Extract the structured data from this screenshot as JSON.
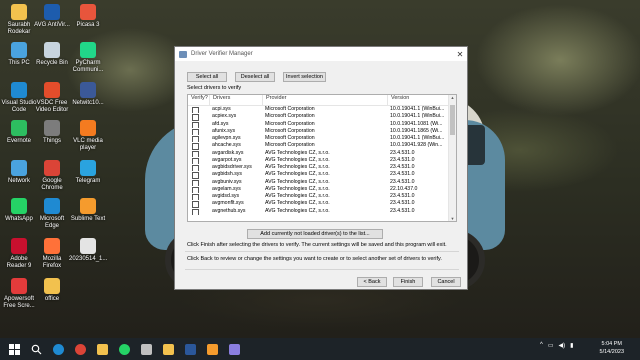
{
  "desktop_icons": [
    {
      "label": "Saurabh Rodekar",
      "icon": "user-folder-icon",
      "color": "#f2c14e"
    },
    {
      "label": "AVG AntiVir...",
      "icon": "avg-icon",
      "color": "#1d5cad"
    },
    {
      "label": "Picasa 3",
      "icon": "picasa-icon",
      "color": "#e8553c"
    },
    {
      "label": "This PC",
      "icon": "computer-icon",
      "color": "#4aa3df"
    },
    {
      "label": "Recycle Bin",
      "icon": "recycle-bin-icon",
      "color": "#c7d4de"
    },
    {
      "label": "PyCharm Communi...",
      "icon": "pycharm-icon",
      "color": "#21d789"
    },
    {
      "label": "Visual Studio Code",
      "icon": "vscode-icon",
      "color": "#1f8ad2"
    },
    {
      "label": "VSDC Free Video Editor",
      "icon": "vsdc-icon",
      "color": "#e34d2b"
    },
    {
      "label": "Netwitc10...",
      "icon": "network-tool-icon",
      "color": "#3b5998"
    },
    {
      "label": "Evernote",
      "icon": "evernote-icon",
      "color": "#2dbe60"
    },
    {
      "label": "Things",
      "icon": "things-icon",
      "color": "#7c7c7c"
    },
    {
      "label": "VLC media player",
      "icon": "vlc-icon",
      "color": "#f47b20"
    },
    {
      "label": "Network",
      "icon": "network-icon",
      "color": "#4aa3df"
    },
    {
      "label": "Google Chrome",
      "icon": "chrome-icon",
      "color": "#db4437"
    },
    {
      "label": "Telegram",
      "icon": "telegram-icon",
      "color": "#2aa3df"
    },
    {
      "label": "WhatsApp",
      "icon": "whatsapp-icon",
      "color": "#25d366"
    },
    {
      "label": "Microsoft Edge",
      "icon": "edge-icon",
      "color": "#1f8ad2"
    },
    {
      "label": "Sublime Text",
      "icon": "sublime-icon",
      "color": "#f59b2d"
    },
    {
      "label": "Adobe Reader 9",
      "icon": "adobe-reader-icon",
      "color": "#c8102e"
    },
    {
      "label": "Mozilla Firefox",
      "icon": "firefox-icon",
      "color": "#ff7139"
    },
    {
      "label": "20230514_1...",
      "icon": "image-file-icon",
      "color": "#e4e4e4"
    },
    {
      "label": "Apowersoft Free Scre...",
      "icon": "apowersoft-icon",
      "color": "#e33b3b"
    },
    {
      "label": "office",
      "icon": "folder-icon",
      "color": "#f2c14e"
    }
  ],
  "dialog": {
    "title": "Driver Verifier Manager",
    "buttons": {
      "select_all": "Select all",
      "deselect_all": "Deselect all",
      "invert": "Invert selection"
    },
    "list_label": "Select drivers to verify",
    "columns": [
      "Verify?",
      "Drivers",
      "Provider",
      "Version"
    ],
    "rows": [
      {
        "driver": "acpi.sys",
        "provider": "Microsoft Corporation",
        "version": "10.0.19041.1 (WinBui..."
      },
      {
        "driver": "acpiex.sys",
        "provider": "Microsoft Corporation",
        "version": "10.0.19041.1 (WinBui..."
      },
      {
        "driver": "afd.sys",
        "provider": "Microsoft Corporation",
        "version": "10.0.19041.1081 (Wi..."
      },
      {
        "driver": "afunix.sys",
        "provider": "Microsoft Corporation",
        "version": "10.0.19041.1865 (Wi..."
      },
      {
        "driver": "agilevpn.sys",
        "provider": "Microsoft Corporation",
        "version": "10.0.19041.1 (WinBui..."
      },
      {
        "driver": "ahcache.sys",
        "provider": "Microsoft Corporation",
        "version": "10.0.19041.928 (Win..."
      },
      {
        "driver": "avgardisk.sys",
        "provider": "AVG Technologies CZ, s.r.o.",
        "version": "23.4.531.0"
      },
      {
        "driver": "avgarpot.sys",
        "provider": "AVG Technologies CZ, s.r.o.",
        "version": "23.4.531.0"
      },
      {
        "driver": "avgbidsdriver.sys",
        "provider": "AVG Technologies CZ, s.r.o.",
        "version": "23.4.531.0"
      },
      {
        "driver": "avgbidsh.sys",
        "provider": "AVG Technologies CZ, s.r.o.",
        "version": "23.4.531.0"
      },
      {
        "driver": "avgbuniv.sys",
        "provider": "AVG Technologies CZ, s.r.o.",
        "version": "23.4.531.0"
      },
      {
        "driver": "avgelam.sys",
        "provider": "AVG Technologies CZ, s.r.o.",
        "version": "22.10.437.0"
      },
      {
        "driver": "avgidsd.sys",
        "provider": "AVG Technologies CZ, s.r.o.",
        "version": "23.4.531.0"
      },
      {
        "driver": "avgmonflt.sys",
        "provider": "AVG Technologies CZ, s.r.o.",
        "version": "23.4.531.0"
      },
      {
        "driver": "avgnethub.sys",
        "provider": "AVG Technologies CZ, s.r.o.",
        "version": "23.4.531.0"
      }
    ],
    "add_button": "Add currently not loaded driver(s) to the list...",
    "info1": "Click Finish after selecting the drivers to verify. The current settings will be saved and this program will exit.",
    "info2": "Click Back to review or change the settings you want to create or to select another set of drivers to verify.",
    "back": "< Back",
    "finish": "Finish",
    "cancel": "Cancel"
  },
  "taskbar": {
    "items": [
      {
        "icon": "start-icon",
        "color": "#ffffff"
      },
      {
        "icon": "search-icon",
        "color": "#ffffff"
      },
      {
        "icon": "edge-icon",
        "color": "#1f8ad2"
      },
      {
        "icon": "chrome-icon",
        "color": "#db4437"
      },
      {
        "icon": "file-explorer-icon",
        "color": "#f2c14e"
      },
      {
        "icon": "whatsapp-icon",
        "color": "#25d366"
      },
      {
        "icon": "app-icon",
        "color": "#c0c0c0"
      },
      {
        "icon": "file-explorer-icon",
        "color": "#f2c14e"
      },
      {
        "icon": "word-icon",
        "color": "#2b579a"
      },
      {
        "icon": "sublime-icon",
        "color": "#f59b2d"
      },
      {
        "icon": "app-icon",
        "color": "#8a7ee0"
      }
    ],
    "time": "5:04 PM",
    "date": "5/14/2023"
  }
}
